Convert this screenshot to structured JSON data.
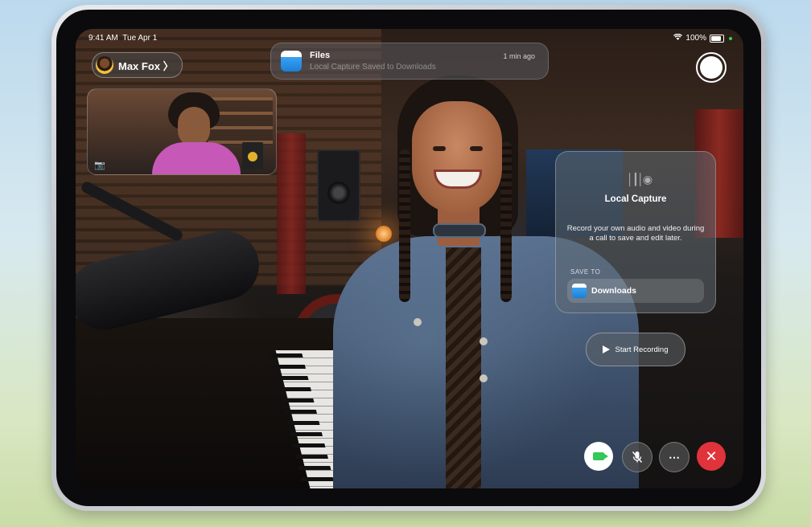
{
  "status_bar": {
    "time": "9:41 AM",
    "date": "Tue Apr 1",
    "battery": "100%"
  },
  "caller": {
    "name": "Max Fox 〉"
  },
  "notification": {
    "app": "Files",
    "message": "Local Capture Saved to Downloads",
    "time": "1 min ago",
    "icon": "files-folder-icon"
  },
  "capture_panel": {
    "title": "Local Capture",
    "description": "Record your own audio and video during a call to save and edit later.",
    "save_to_label": "SAVE TO",
    "destination": "Downloads",
    "icon": "waveform-icon"
  },
  "record_button": {
    "label": "Start Recording",
    "icon": "play-icon"
  },
  "controls": {
    "video": "video-camera-icon",
    "mute": "mic-slash-icon",
    "more": "⋯",
    "end": "✕"
  },
  "colors": {
    "accent_green": "#34c759",
    "end_red": "#e0333b"
  }
}
